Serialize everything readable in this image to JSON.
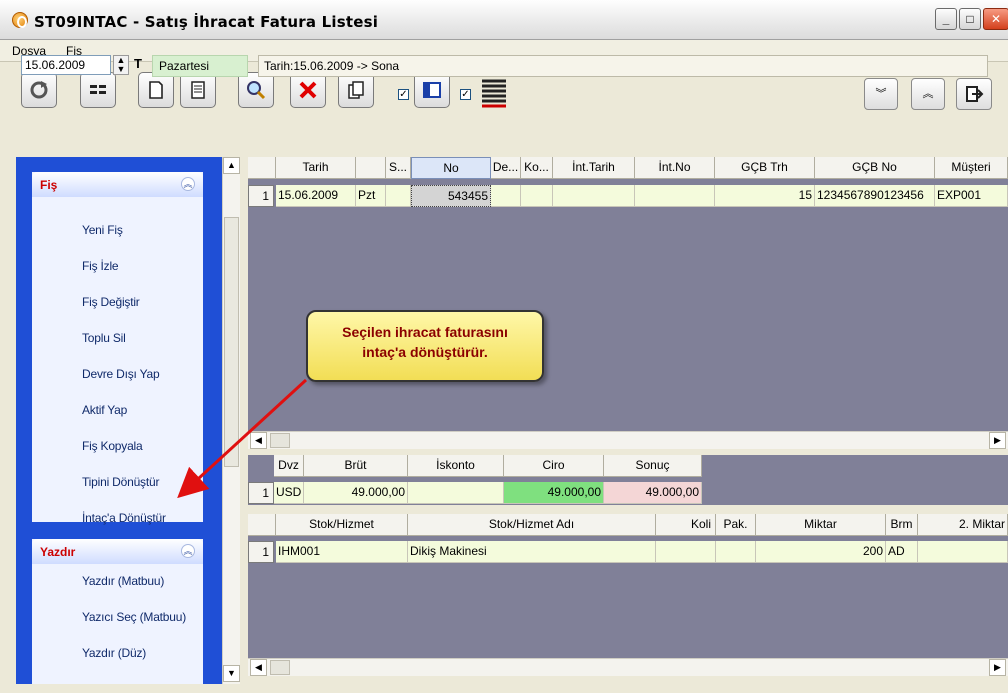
{
  "window": {
    "title": "ST09INTAC - Satış İhracat Fatura Listesi"
  },
  "menu": [
    "Dosya",
    "Fiş"
  ],
  "toolbar": {
    "date": "15.06.2009",
    "t_label": "T",
    "day": "Pazartesi",
    "range": "Tarih:15.06.2009 -> Sona"
  },
  "groups": [
    {
      "title": "Fiş",
      "items": [
        "Yeni Fiş",
        "Fiş İzle",
        "Fiş Değiştir",
        "Toplu Sil",
        "Devre Dışı Yap",
        "Aktif Yap",
        "Fiş Kopyala",
        "Tipini Dönüştür",
        "İntaç'a Dönüştür"
      ]
    },
    {
      "title": "Yazdır",
      "items": [
        "Yazdır (Matbuu)",
        "Yazıcı Seç (Matbuu)",
        "Yazdır (Düz)"
      ]
    }
  ],
  "main_grid": {
    "headers": [
      "Tarih",
      "S...",
      "No",
      "De...",
      "Ko...",
      "İnt.Tarih",
      "İnt.No",
      "GÇB Trh",
      "GÇB No",
      "Müşteri"
    ],
    "row": {
      "num": "1",
      "tarih": "15.06.2009",
      "day": "Pzt",
      "no": "543455",
      "gcb_trh": "15",
      "gcb_no": "1234567890123456",
      "musteri": "EXP001"
    }
  },
  "currency_grid": {
    "headers": [
      "Dvz",
      "Brüt",
      "İskonto",
      "Ciro",
      "Sonuç"
    ],
    "row": {
      "num": "1",
      "dvz": "USD",
      "brut": "49.000,00",
      "iskonto": "",
      "ciro": "49.000,00",
      "sonuc": "49.000,00"
    }
  },
  "item_grid": {
    "headers": [
      "Stok/Hizmet",
      "Stok/Hizmet Adı",
      "Koli",
      "Pak.",
      "Miktar",
      "Brm",
      "2. Miktar"
    ],
    "row": {
      "num": "1",
      "kod": "IHM001",
      "ad": "Dikiş Makinesi",
      "miktar": "200",
      "brm": "AD"
    }
  },
  "callout": {
    "line1": "Seçilen ihracat faturasını",
    "line2": "intaç'a dönüştürür."
  },
  "colors": {
    "panel": "#1f4fd6",
    "grid_bg": "#808098",
    "ciro_bg": "#7fe07f",
    "sonuc_bg": "#f4d6d6",
    "row_bg": "#f4fbdc"
  }
}
